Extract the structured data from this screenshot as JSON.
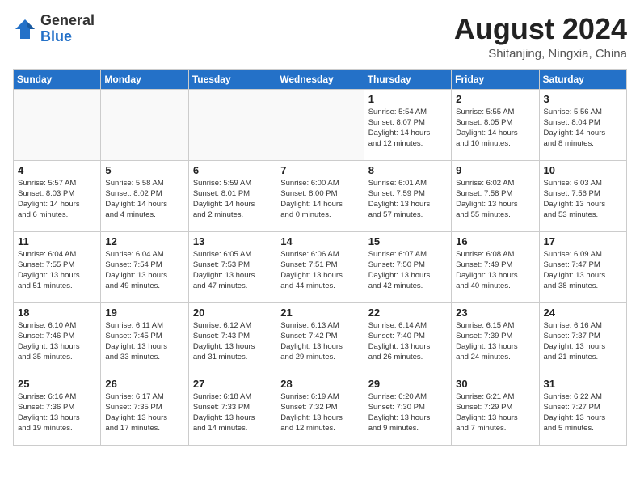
{
  "header": {
    "logo_general": "General",
    "logo_blue": "Blue",
    "month_year": "August 2024",
    "location": "Shitanjing, Ningxia, China"
  },
  "calendar": {
    "weekdays": [
      "Sunday",
      "Monday",
      "Tuesday",
      "Wednesday",
      "Thursday",
      "Friday",
      "Saturday"
    ],
    "weeks": [
      [
        {
          "day": "",
          "info": ""
        },
        {
          "day": "",
          "info": ""
        },
        {
          "day": "",
          "info": ""
        },
        {
          "day": "",
          "info": ""
        },
        {
          "day": "1",
          "info": "Sunrise: 5:54 AM\nSunset: 8:07 PM\nDaylight: 14 hours\nand 12 minutes."
        },
        {
          "day": "2",
          "info": "Sunrise: 5:55 AM\nSunset: 8:05 PM\nDaylight: 14 hours\nand 10 minutes."
        },
        {
          "day": "3",
          "info": "Sunrise: 5:56 AM\nSunset: 8:04 PM\nDaylight: 14 hours\nand 8 minutes."
        }
      ],
      [
        {
          "day": "4",
          "info": "Sunrise: 5:57 AM\nSunset: 8:03 PM\nDaylight: 14 hours\nand 6 minutes."
        },
        {
          "day": "5",
          "info": "Sunrise: 5:58 AM\nSunset: 8:02 PM\nDaylight: 14 hours\nand 4 minutes."
        },
        {
          "day": "6",
          "info": "Sunrise: 5:59 AM\nSunset: 8:01 PM\nDaylight: 14 hours\nand 2 minutes."
        },
        {
          "day": "7",
          "info": "Sunrise: 6:00 AM\nSunset: 8:00 PM\nDaylight: 14 hours\nand 0 minutes."
        },
        {
          "day": "8",
          "info": "Sunrise: 6:01 AM\nSunset: 7:59 PM\nDaylight: 13 hours\nand 57 minutes."
        },
        {
          "day": "9",
          "info": "Sunrise: 6:02 AM\nSunset: 7:58 PM\nDaylight: 13 hours\nand 55 minutes."
        },
        {
          "day": "10",
          "info": "Sunrise: 6:03 AM\nSunset: 7:56 PM\nDaylight: 13 hours\nand 53 minutes."
        }
      ],
      [
        {
          "day": "11",
          "info": "Sunrise: 6:04 AM\nSunset: 7:55 PM\nDaylight: 13 hours\nand 51 minutes."
        },
        {
          "day": "12",
          "info": "Sunrise: 6:04 AM\nSunset: 7:54 PM\nDaylight: 13 hours\nand 49 minutes."
        },
        {
          "day": "13",
          "info": "Sunrise: 6:05 AM\nSunset: 7:53 PM\nDaylight: 13 hours\nand 47 minutes."
        },
        {
          "day": "14",
          "info": "Sunrise: 6:06 AM\nSunset: 7:51 PM\nDaylight: 13 hours\nand 44 minutes."
        },
        {
          "day": "15",
          "info": "Sunrise: 6:07 AM\nSunset: 7:50 PM\nDaylight: 13 hours\nand 42 minutes."
        },
        {
          "day": "16",
          "info": "Sunrise: 6:08 AM\nSunset: 7:49 PM\nDaylight: 13 hours\nand 40 minutes."
        },
        {
          "day": "17",
          "info": "Sunrise: 6:09 AM\nSunset: 7:47 PM\nDaylight: 13 hours\nand 38 minutes."
        }
      ],
      [
        {
          "day": "18",
          "info": "Sunrise: 6:10 AM\nSunset: 7:46 PM\nDaylight: 13 hours\nand 35 minutes."
        },
        {
          "day": "19",
          "info": "Sunrise: 6:11 AM\nSunset: 7:45 PM\nDaylight: 13 hours\nand 33 minutes."
        },
        {
          "day": "20",
          "info": "Sunrise: 6:12 AM\nSunset: 7:43 PM\nDaylight: 13 hours\nand 31 minutes."
        },
        {
          "day": "21",
          "info": "Sunrise: 6:13 AM\nSunset: 7:42 PM\nDaylight: 13 hours\nand 29 minutes."
        },
        {
          "day": "22",
          "info": "Sunrise: 6:14 AM\nSunset: 7:40 PM\nDaylight: 13 hours\nand 26 minutes."
        },
        {
          "day": "23",
          "info": "Sunrise: 6:15 AM\nSunset: 7:39 PM\nDaylight: 13 hours\nand 24 minutes."
        },
        {
          "day": "24",
          "info": "Sunrise: 6:16 AM\nSunset: 7:37 PM\nDaylight: 13 hours\nand 21 minutes."
        }
      ],
      [
        {
          "day": "25",
          "info": "Sunrise: 6:16 AM\nSunset: 7:36 PM\nDaylight: 13 hours\nand 19 minutes."
        },
        {
          "day": "26",
          "info": "Sunrise: 6:17 AM\nSunset: 7:35 PM\nDaylight: 13 hours\nand 17 minutes."
        },
        {
          "day": "27",
          "info": "Sunrise: 6:18 AM\nSunset: 7:33 PM\nDaylight: 13 hours\nand 14 minutes."
        },
        {
          "day": "28",
          "info": "Sunrise: 6:19 AM\nSunset: 7:32 PM\nDaylight: 13 hours\nand 12 minutes."
        },
        {
          "day": "29",
          "info": "Sunrise: 6:20 AM\nSunset: 7:30 PM\nDaylight: 13 hours\nand 9 minutes."
        },
        {
          "day": "30",
          "info": "Sunrise: 6:21 AM\nSunset: 7:29 PM\nDaylight: 13 hours\nand 7 minutes."
        },
        {
          "day": "31",
          "info": "Sunrise: 6:22 AM\nSunset: 7:27 PM\nDaylight: 13 hours\nand 5 minutes."
        }
      ]
    ]
  }
}
